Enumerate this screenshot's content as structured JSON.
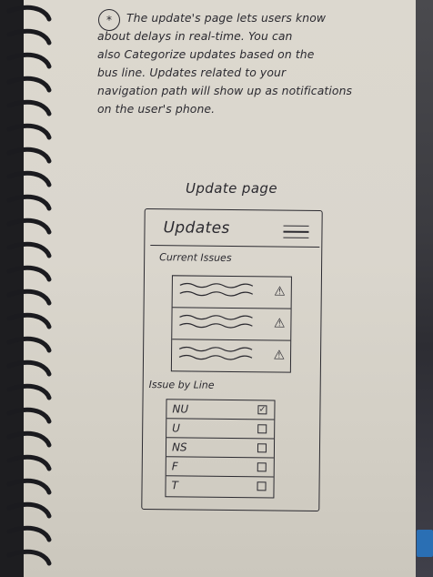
{
  "note": {
    "marker": "*",
    "lines": [
      "The update's page lets users know",
      "about delays in real-time. You can",
      "also Categorize updates based on the",
      "bus line. Updates related to your",
      "navigation path will show up as notifications",
      "on the user's phone."
    ]
  },
  "caption": "Update page",
  "app": {
    "title": "Updates",
    "current_issues_label": "Current Issues",
    "issues": [
      {
        "icon": "warning-icon"
      },
      {
        "icon": "warning-icon"
      },
      {
        "icon": "warning-icon"
      }
    ],
    "by_line_label": "Issue by Line",
    "lines": [
      {
        "name": "NU",
        "checked": true
      },
      {
        "name": "U",
        "checked": false
      },
      {
        "name": "NS",
        "checked": false
      },
      {
        "name": "F",
        "checked": false
      },
      {
        "name": "T",
        "checked": false
      }
    ]
  },
  "colors": {
    "ink": "#2b2a30",
    "paper": "#dad6cd",
    "binding": "#1d1d20",
    "tab": "#2a6fb4"
  }
}
